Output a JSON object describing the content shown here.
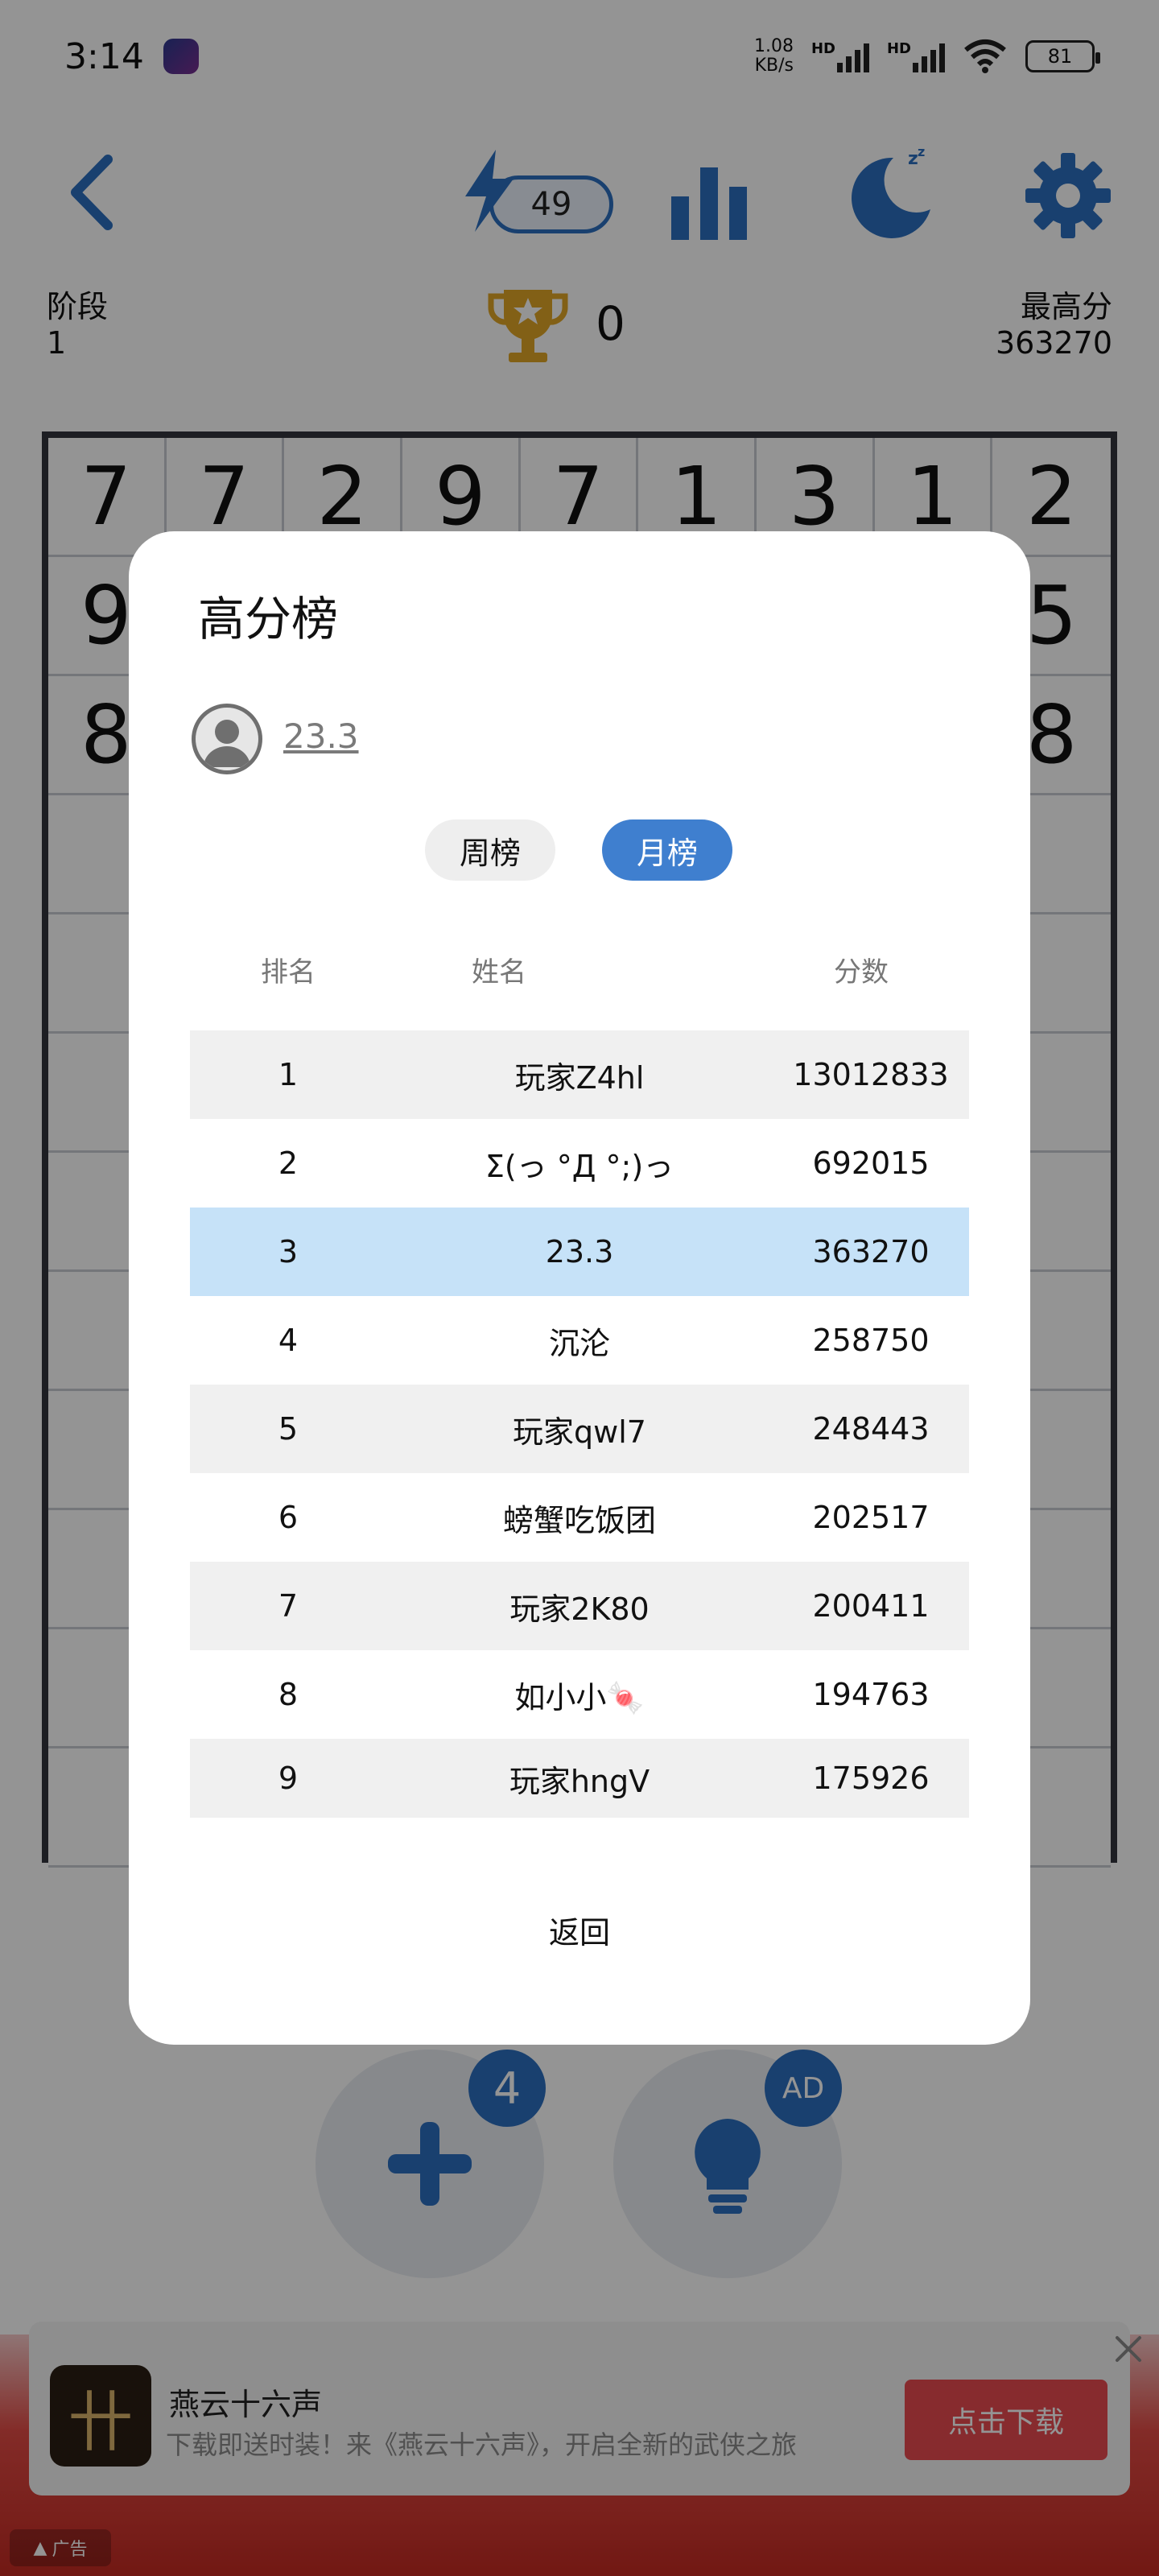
{
  "status_bar": {
    "time": "3:14",
    "net_speed_value": "1.08",
    "net_speed_unit": "KB/s",
    "signal_label": "HD",
    "battery": "81"
  },
  "header": {
    "energy_count": "49"
  },
  "game": {
    "stage_label": "阶段",
    "stage_value": "1",
    "score": "0",
    "best_label": "最高分",
    "best_value": "363270",
    "grid_rows": [
      [
        "7",
        "7",
        "2",
        "9",
        "7",
        "1",
        "3",
        "1",
        "2"
      ],
      [
        "9",
        "",
        "",
        "",
        "",
        "",
        "",
        "",
        "5"
      ],
      [
        "8",
        "",
        "",
        "",
        "",
        "",
        "",
        "",
        "8"
      ],
      [
        "",
        "",
        "",
        "",
        "",
        "",
        "",
        "",
        ""
      ],
      [
        "",
        "",
        "",
        "",
        "",
        "",
        "",
        "",
        ""
      ],
      [
        "",
        "",
        "",
        "",
        "",
        "",
        "",
        "",
        ""
      ],
      [
        "",
        "",
        "",
        "",
        "",
        "",
        "",
        "",
        ""
      ],
      [
        "",
        "",
        "",
        "",
        "",
        "",
        "",
        "",
        ""
      ],
      [
        "",
        "",
        "",
        "",
        "",
        "",
        "",
        "",
        ""
      ],
      [
        "",
        "",
        "",
        "",
        "",
        "",
        "",
        "",
        ""
      ],
      [
        "",
        "",
        "",
        "",
        "",
        "",
        "",
        "",
        ""
      ],
      [
        "",
        "",
        "",
        "",
        "",
        "",
        "",
        "",
        ""
      ]
    ]
  },
  "buttons": {
    "add_badge": "4",
    "hint_badge": "AD"
  },
  "ad": {
    "app_name": "燕云十六声",
    "description": "下载即送时装！来《燕云十六声》，开启全新的武侠之旅",
    "download_label": "点击下载",
    "tag": "广告"
  },
  "leaderboard": {
    "title": "高分榜",
    "current_user": "23.3",
    "tabs": {
      "weekly": "周榜",
      "monthly": "月榜"
    },
    "columns": {
      "rank": "排名",
      "name": "姓名",
      "score": "分数"
    },
    "rows": [
      {
        "rank": "1",
        "name": "玩家Z4hl",
        "score": "13012833"
      },
      {
        "rank": "2",
        "name": "Σ(っ °Д °;)っ",
        "score": "692015"
      },
      {
        "rank": "3",
        "name": "23.3",
        "score": "363270"
      },
      {
        "rank": "4",
        "name": "沉沦",
        "score": "258750"
      },
      {
        "rank": "5",
        "name": "玩家qwl7",
        "score": "248443"
      },
      {
        "rank": "6",
        "name": "螃蟹吃饭团",
        "score": "202517"
      },
      {
        "rank": "7",
        "name": "玩家2K80",
        "score": "200411"
      },
      {
        "rank": "8",
        "name": "如小小🍬",
        "score": "194763"
      },
      {
        "rank": "9",
        "name": "玩家hngV",
        "score": "175926"
      }
    ],
    "return_label": "返回"
  },
  "colors": {
    "accent": "#2b6fc0",
    "highlight_row": "#c6e2f8",
    "tab_active": "#3f7fcf",
    "trophy": "#e0a526",
    "ad_button": "#e84a50"
  }
}
